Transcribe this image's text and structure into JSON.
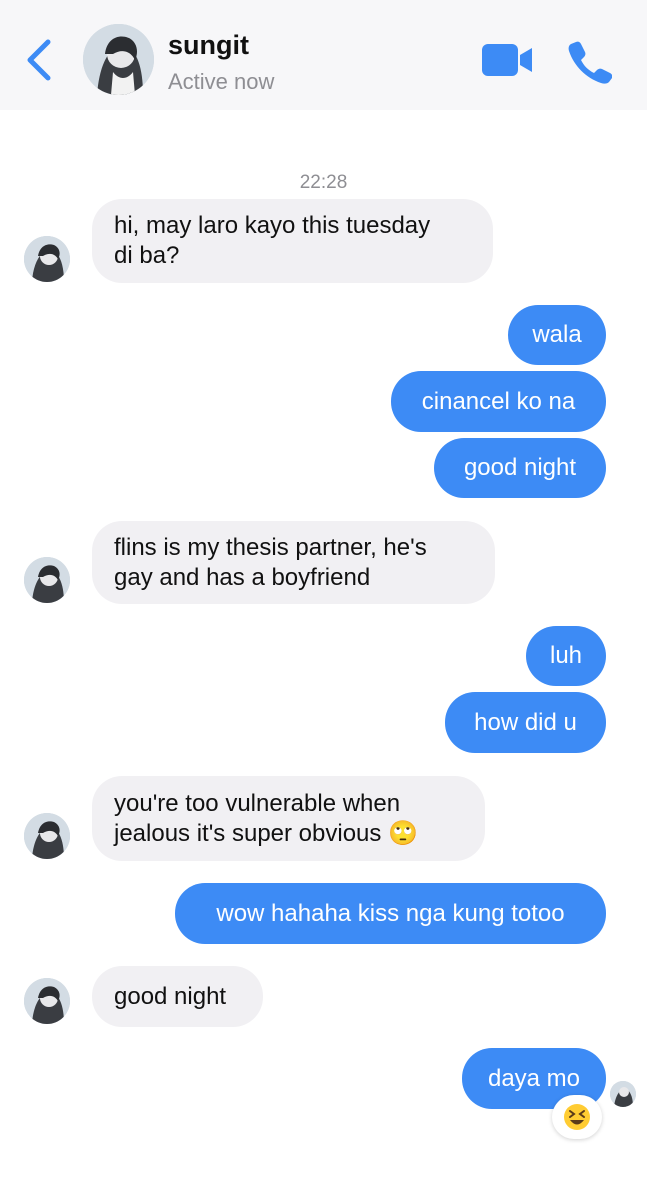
{
  "header": {
    "contact_name": "sungit",
    "status": "Active now"
  },
  "conversation": {
    "timestamp": "22:28",
    "messages": [
      {
        "from": "contact",
        "lines": [
          "hi, may laro kayo this tuesday",
          "di ba?"
        ]
      },
      {
        "from": "me",
        "text": "wala"
      },
      {
        "from": "me",
        "text": "cinancel ko na"
      },
      {
        "from": "me",
        "text": "good night"
      },
      {
        "from": "contact",
        "lines": [
          "flins is my thesis partner, he's",
          "gay and has a boyfriend"
        ]
      },
      {
        "from": "me",
        "text": "luh"
      },
      {
        "from": "me",
        "text": "how did u"
      },
      {
        "from": "contact",
        "lines": [
          "you're too vulnerable when",
          "jealous it's super obvious 🙄"
        ]
      },
      {
        "from": "me",
        "text": "wow hahaha kiss nga kung totoo"
      },
      {
        "from": "contact",
        "text": "good night"
      },
      {
        "from": "me",
        "text": "daya mo",
        "reaction": "😆"
      }
    ]
  },
  "colors": {
    "accent": "#3d8bf5",
    "incoming_bubble": "#f1f0f3",
    "header_bg": "#f7f7f9",
    "muted_text": "#8e8e93"
  },
  "icons": {
    "back": "chevron-left-icon",
    "video": "video-camera-icon",
    "call": "phone-icon"
  }
}
